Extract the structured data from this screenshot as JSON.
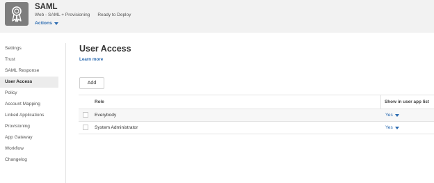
{
  "app": {
    "title": "SAML",
    "subtitle": "Web - SAML + Provisioning",
    "status": "Ready to Deploy",
    "actions_label": "Actions"
  },
  "sidebar": {
    "items": [
      {
        "label": "Settings"
      },
      {
        "label": "Trust"
      },
      {
        "label": "SAML Response"
      },
      {
        "label": "User Access",
        "active": true
      },
      {
        "label": "Policy"
      },
      {
        "label": "Account Mapping"
      },
      {
        "label": "Linked Applications"
      },
      {
        "label": "Provisioning"
      },
      {
        "label": "App Gateway"
      },
      {
        "label": "Workflow"
      },
      {
        "label": "Changelog"
      }
    ]
  },
  "main": {
    "title": "User Access",
    "learn_more": "Learn more",
    "add_label": "Add",
    "table": {
      "columns": [
        "Role",
        "Show in user app list"
      ],
      "rows": [
        {
          "role": "Everybody",
          "show": "Yes"
        },
        {
          "role": "System Administrator",
          "show": "Yes"
        }
      ]
    }
  },
  "colors": {
    "accent": "#2a6ab0",
    "header_bg": "#f2f2f2",
    "logo_bg": "#7d7d7d"
  }
}
